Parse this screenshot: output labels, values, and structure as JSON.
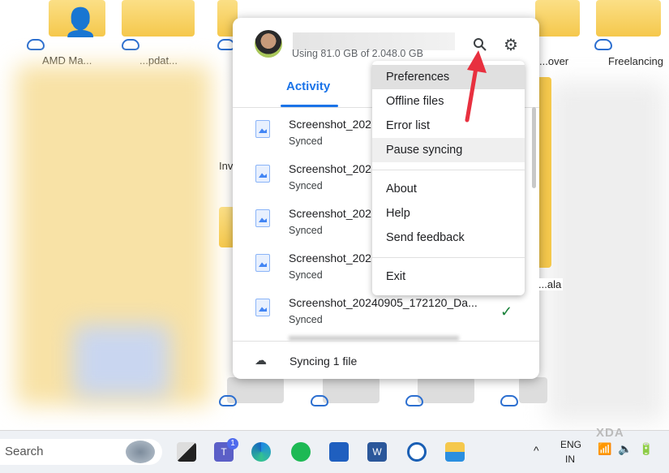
{
  "desktop": {
    "labels": [
      "AMD Ma...",
      "...pdat...",
      "...over",
      "Freelancing",
      "Inv...",
      "...ala"
    ]
  },
  "account": {
    "usage": "Using 81.0 GB of 2.048.0 GB"
  },
  "tabs": {
    "activity": "Activity"
  },
  "files": [
    {
      "name": "Screenshot_202",
      "status": "Synced",
      "synced_check": false
    },
    {
      "name": "Screenshot_202",
      "status": "Synced",
      "synced_check": false
    },
    {
      "name": "Screenshot_202",
      "status": "Synced",
      "synced_check": false
    },
    {
      "name": "Screenshot_202",
      "status": "Synced",
      "synced_check": false
    },
    {
      "name": "Screenshot_20240905_172120_Da...",
      "status": "Synced",
      "synced_check": true
    }
  ],
  "footer": {
    "status": "Syncing 1 file"
  },
  "menu": {
    "items": [
      "Preferences",
      "Offline files",
      "Error list",
      "Pause syncing",
      "About",
      "Help",
      "Send feedback",
      "Exit"
    ]
  },
  "taskbar": {
    "search_placeholder": "Search",
    "teams_badge": "1",
    "lang1": "ENG",
    "lang2": "IN",
    "watermark": "XDA"
  },
  "colors": {
    "accent": "#1a73e8",
    "arrow": "#e8303f"
  }
}
